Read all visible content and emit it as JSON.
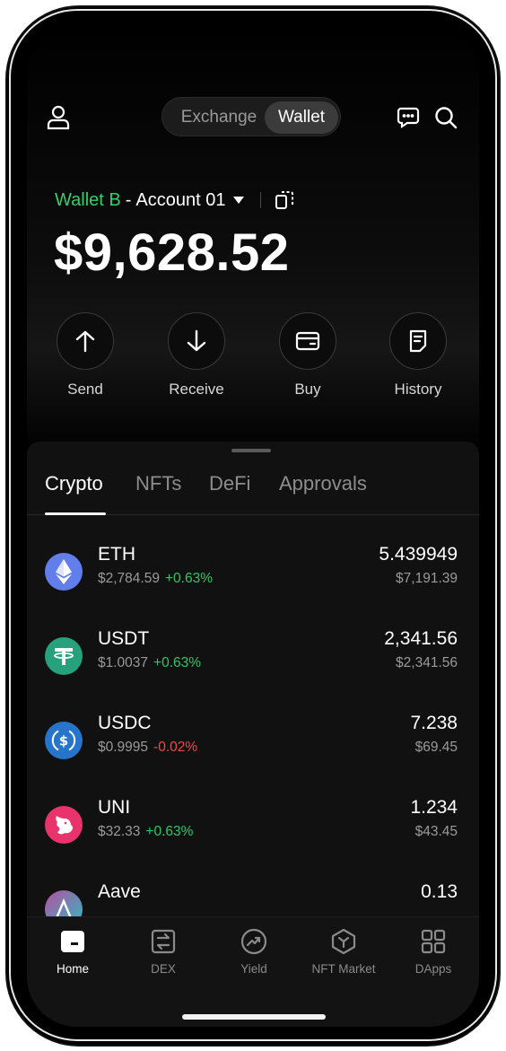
{
  "header": {
    "segments": [
      {
        "label": "Exchange"
      },
      {
        "label": "Wallet"
      }
    ],
    "active_segment": "Wallet"
  },
  "account": {
    "wallet_name": "Wallet B",
    "separator": "-",
    "account_name": "Account 01",
    "balance": "$9,628.52"
  },
  "actions": [
    {
      "label": "Send",
      "icon": "arrow-up-icon"
    },
    {
      "label": "Receive",
      "icon": "arrow-down-icon"
    },
    {
      "label": "Buy",
      "icon": "wallet-icon"
    },
    {
      "label": "History",
      "icon": "document-icon"
    }
  ],
  "tabs": {
    "items": [
      {
        "label": "Crypto"
      },
      {
        "label": "NFTs"
      },
      {
        "label": "DeFi"
      },
      {
        "label": "Approvals"
      }
    ],
    "active": "Crypto"
  },
  "assets": [
    {
      "symbol": "ETH",
      "price": "$2,784.59",
      "change": "+0.63%",
      "direction": "up",
      "amount": "5.439949",
      "value": "$7,191.39",
      "color": "#627eea",
      "icon": "ethereum-icon"
    },
    {
      "symbol": "USDT",
      "price": "$1.0037",
      "change": "+0.63%",
      "direction": "up",
      "amount": "2,341.56",
      "value": "$2,341.56",
      "color": "#26a17b",
      "icon": "tether-icon"
    },
    {
      "symbol": "USDC",
      "price": "$0.9995",
      "change": "-0.02%",
      "direction": "down",
      "amount": "7.238",
      "value": "$69.45",
      "color": "#2775ca",
      "icon": "usdc-icon"
    },
    {
      "symbol": "UNI",
      "price": "$32.33",
      "change": "+0.63%",
      "direction": "up",
      "amount": "1.234",
      "value": "$43.45",
      "color": "#e8336d",
      "icon": "uniswap-icon"
    },
    {
      "symbol": "Aave",
      "price": "",
      "change": "",
      "direction": "up",
      "amount": "0.13",
      "value": "",
      "color": "#9b52c6",
      "icon": "aave-icon"
    }
  ],
  "bottom_nav": {
    "items": [
      {
        "label": "Home",
        "icon": "home-icon"
      },
      {
        "label": "DEX",
        "icon": "dex-icon"
      },
      {
        "label": "Yield",
        "icon": "yield-icon"
      },
      {
        "label": "NFT Market",
        "icon": "nft-market-icon"
      },
      {
        "label": "DApps",
        "icon": "dapps-icon"
      }
    ],
    "active": "Home"
  },
  "colors": {
    "accent_green": "#32d16a",
    "positive": "#30c56a",
    "negative": "#ea4c4c",
    "background": "#000000",
    "sheet": "#111111"
  }
}
